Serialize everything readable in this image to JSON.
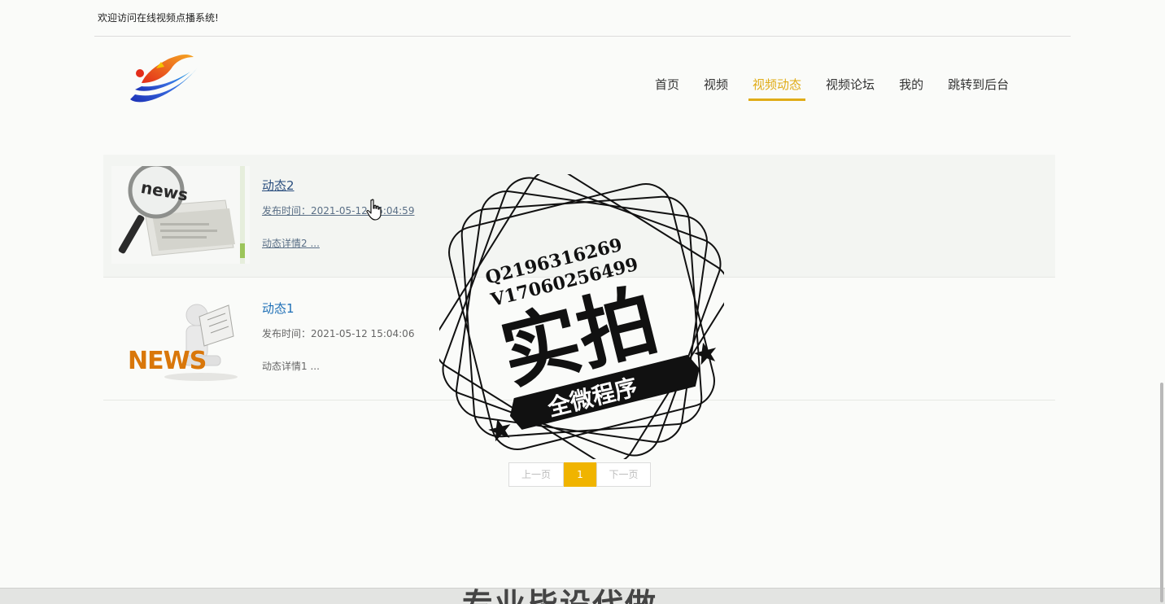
{
  "topbar": {
    "welcome": "欢迎访问在线视频点播系统!"
  },
  "nav": {
    "items": [
      {
        "label": "首页",
        "active": false
      },
      {
        "label": "视频",
        "active": false
      },
      {
        "label": "视频动态",
        "active": true
      },
      {
        "label": "视频论坛",
        "active": false
      },
      {
        "label": "我的",
        "active": false
      },
      {
        "label": "跳转到后台",
        "active": false
      }
    ]
  },
  "news": [
    {
      "title": "动态2",
      "time": "发布时间：2021-05-12 15:04:59",
      "desc": "动态详情2 ...",
      "thumb_icon": "news-magnifier-image"
    },
    {
      "title": "动态1",
      "time": "发布时间：2021-05-12 15:04:06",
      "desc": "动态详情1 ...",
      "thumb_icon": "news-reader-figure-image"
    }
  ],
  "pager": {
    "prev": "上一页",
    "current": "1",
    "next": "下一页"
  },
  "stamp": {
    "line1": "Q2196316269",
    "line2": "V17060256499",
    "big": "实拍",
    "banner": "全微程序"
  },
  "bottom": {
    "text": "专业毕设代做"
  },
  "colors": {
    "accent": "#e0ac17",
    "link": "#1e6fb6",
    "pager_active": "#f0b400"
  }
}
